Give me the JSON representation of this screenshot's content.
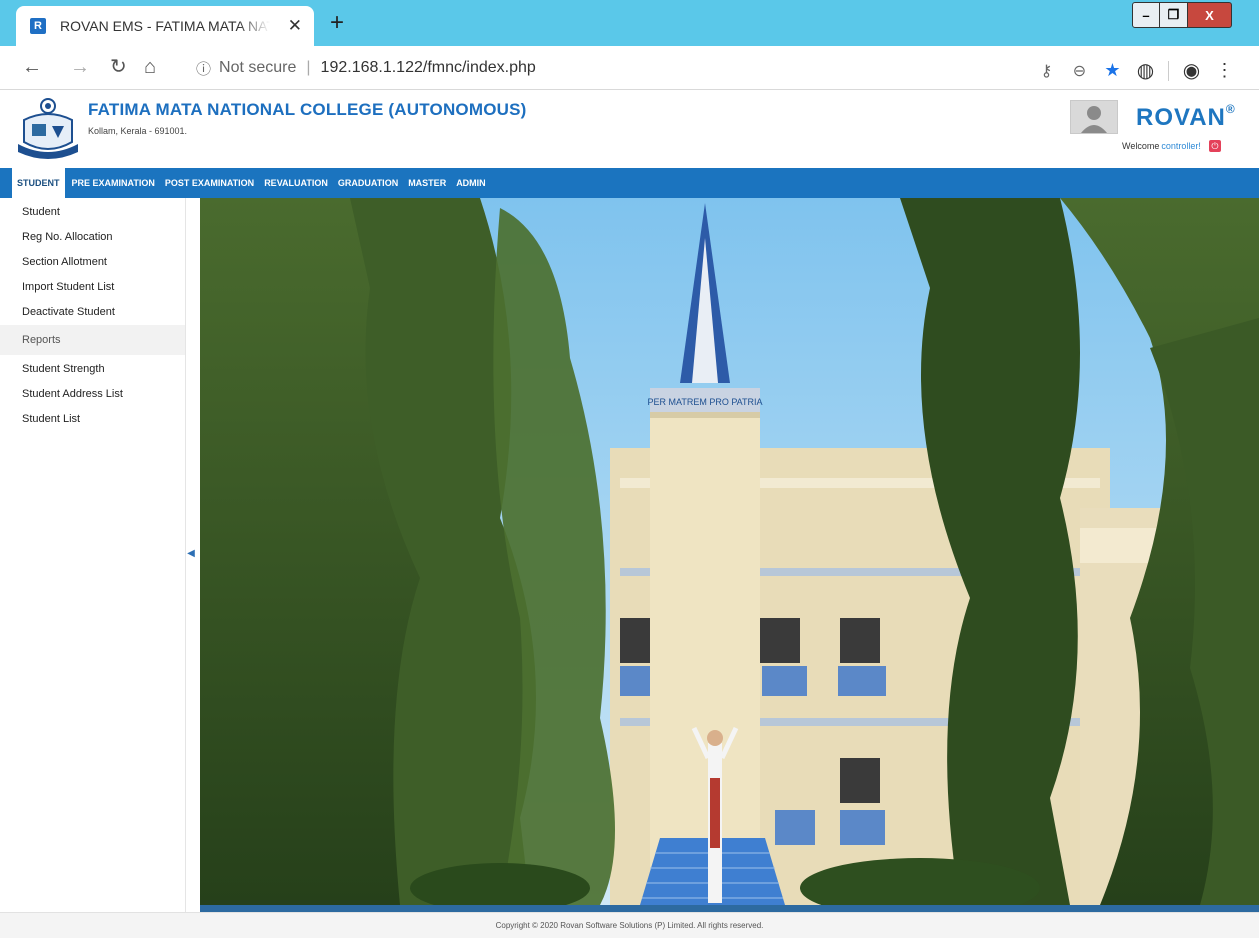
{
  "browser": {
    "tab_title": "ROVAN EMS - FATIMA MATA NATIONAL COLLEGE",
    "tab_favicon": "R",
    "new_tab": "+",
    "close_tab": "✕",
    "security_label": "Not secure",
    "url": "192.168.1.122/fmnc/index.php",
    "window_controls": {
      "minimize": "–",
      "maximize": "❐",
      "close": "X"
    }
  },
  "header": {
    "college_name": "FATIMA MATA NATIONAL COLLEGE (AUTONOMOUS)",
    "college_address": "Kollam, Kerala - 691001.",
    "brand": "ROVAN",
    "brand_mark": "®",
    "welcome_prefix": "Welcome",
    "welcome_user": "controller!"
  },
  "menu": {
    "items": [
      "STUDENT",
      "PRE EXAMINATION",
      "POST EXAMINATION",
      "REVALUATION",
      "GRADUATION",
      "MASTER",
      "ADMIN"
    ],
    "active": "STUDENT"
  },
  "sidebar": {
    "links": [
      "Student",
      "Reg No. Allocation",
      "Section Allotment",
      "Import Student List",
      "Deactivate Student"
    ],
    "section_title": "Reports",
    "report_links": [
      "Student Strength",
      "Student Address List",
      "Student List"
    ]
  },
  "photo": {
    "banner_text": "PER MATREM PRO PATRIA"
  },
  "footer": {
    "copyright": "Copyright © 2020 Rovan Software Solutions (P) Limited. All rights reserved."
  },
  "colors": {
    "chrome": "#5ac8e9",
    "menu": "#1b74bf",
    "brand": "#1e76c0",
    "title": "#1d6fbf"
  },
  "icons": [
    "back-icon",
    "forward-icon",
    "reload-icon",
    "home-icon",
    "info-icon",
    "key-icon",
    "zoom-icon",
    "star-icon",
    "extension-icon",
    "account-icon",
    "menu-dots-icon",
    "logout-icon",
    "collapse-arrow-icon"
  ]
}
